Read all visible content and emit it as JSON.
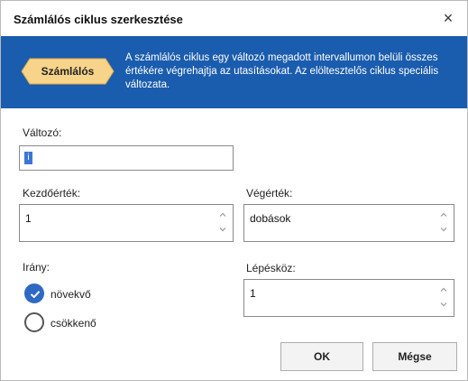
{
  "dialog": {
    "title": "Számlálós ciklus szerkesztése",
    "close_label": "×"
  },
  "banner": {
    "badge": "Számlálós",
    "description": "A számlálós ciklus egy változó megadott intervallumon belüli összes értékére végrehajtja az utasításokat. Az elöltesztelős ciklus speciális változata."
  },
  "form": {
    "variable_label": "Változó:",
    "variable_value": "i",
    "start_label": "Kezdőérték:",
    "start_value": "1",
    "end_label": "Végérték:",
    "end_value": "dobások",
    "direction_label": "Irány:",
    "direction_options": [
      "növekvő",
      "csökkenő"
    ],
    "direction_selected": "növekvő",
    "step_label": "Lépésköz:",
    "step_value": "1"
  },
  "buttons": {
    "ok": "OK",
    "cancel": "Mégse"
  },
  "colors": {
    "banner_bg": "#1a5cad",
    "badge_bg": "#f7d48a",
    "radio_selected": "#2e69c4"
  }
}
